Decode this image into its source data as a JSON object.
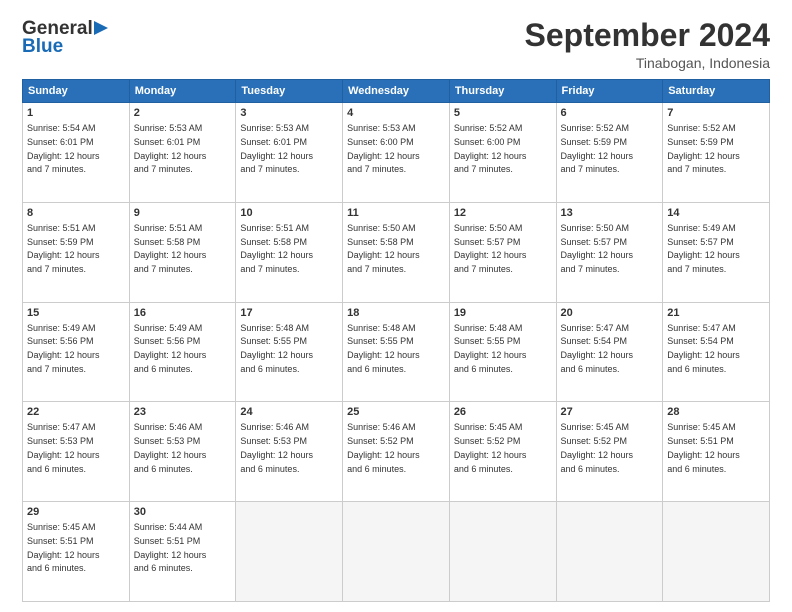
{
  "header": {
    "logo_general": "General",
    "logo_blue": "Blue",
    "month_title": "September 2024",
    "subtitle": "Tinabogan, Indonesia"
  },
  "days_of_week": [
    "Sunday",
    "Monday",
    "Tuesday",
    "Wednesday",
    "Thursday",
    "Friday",
    "Saturday"
  ],
  "weeks": [
    [
      {
        "day": 1,
        "sunrise": "5:54 AM",
        "sunset": "6:01 PM",
        "daylight": "12 hours and 7 minutes."
      },
      {
        "day": 2,
        "sunrise": "5:53 AM",
        "sunset": "6:01 PM",
        "daylight": "12 hours and 7 minutes."
      },
      {
        "day": 3,
        "sunrise": "5:53 AM",
        "sunset": "6:01 PM",
        "daylight": "12 hours and 7 minutes."
      },
      {
        "day": 4,
        "sunrise": "5:53 AM",
        "sunset": "6:00 PM",
        "daylight": "12 hours and 7 minutes."
      },
      {
        "day": 5,
        "sunrise": "5:52 AM",
        "sunset": "6:00 PM",
        "daylight": "12 hours and 7 minutes."
      },
      {
        "day": 6,
        "sunrise": "5:52 AM",
        "sunset": "5:59 PM",
        "daylight": "12 hours and 7 minutes."
      },
      {
        "day": 7,
        "sunrise": "5:52 AM",
        "sunset": "5:59 PM",
        "daylight": "12 hours and 7 minutes."
      }
    ],
    [
      {
        "day": 8,
        "sunrise": "5:51 AM",
        "sunset": "5:59 PM",
        "daylight": "12 hours and 7 minutes."
      },
      {
        "day": 9,
        "sunrise": "5:51 AM",
        "sunset": "5:58 PM",
        "daylight": "12 hours and 7 minutes."
      },
      {
        "day": 10,
        "sunrise": "5:51 AM",
        "sunset": "5:58 PM",
        "daylight": "12 hours and 7 minutes."
      },
      {
        "day": 11,
        "sunrise": "5:50 AM",
        "sunset": "5:58 PM",
        "daylight": "12 hours and 7 minutes."
      },
      {
        "day": 12,
        "sunrise": "5:50 AM",
        "sunset": "5:57 PM",
        "daylight": "12 hours and 7 minutes."
      },
      {
        "day": 13,
        "sunrise": "5:50 AM",
        "sunset": "5:57 PM",
        "daylight": "12 hours and 7 minutes."
      },
      {
        "day": 14,
        "sunrise": "5:49 AM",
        "sunset": "5:57 PM",
        "daylight": "12 hours and 7 minutes."
      }
    ],
    [
      {
        "day": 15,
        "sunrise": "5:49 AM",
        "sunset": "5:56 PM",
        "daylight": "12 hours and 7 minutes."
      },
      {
        "day": 16,
        "sunrise": "5:49 AM",
        "sunset": "5:56 PM",
        "daylight": "12 hours and 6 minutes."
      },
      {
        "day": 17,
        "sunrise": "5:48 AM",
        "sunset": "5:55 PM",
        "daylight": "12 hours and 6 minutes."
      },
      {
        "day": 18,
        "sunrise": "5:48 AM",
        "sunset": "5:55 PM",
        "daylight": "12 hours and 6 minutes."
      },
      {
        "day": 19,
        "sunrise": "5:48 AM",
        "sunset": "5:55 PM",
        "daylight": "12 hours and 6 minutes."
      },
      {
        "day": 20,
        "sunrise": "5:47 AM",
        "sunset": "5:54 PM",
        "daylight": "12 hours and 6 minutes."
      },
      {
        "day": 21,
        "sunrise": "5:47 AM",
        "sunset": "5:54 PM",
        "daylight": "12 hours and 6 minutes."
      }
    ],
    [
      {
        "day": 22,
        "sunrise": "5:47 AM",
        "sunset": "5:53 PM",
        "daylight": "12 hours and 6 minutes."
      },
      {
        "day": 23,
        "sunrise": "5:46 AM",
        "sunset": "5:53 PM",
        "daylight": "12 hours and 6 minutes."
      },
      {
        "day": 24,
        "sunrise": "5:46 AM",
        "sunset": "5:53 PM",
        "daylight": "12 hours and 6 minutes."
      },
      {
        "day": 25,
        "sunrise": "5:46 AM",
        "sunset": "5:52 PM",
        "daylight": "12 hours and 6 minutes."
      },
      {
        "day": 26,
        "sunrise": "5:45 AM",
        "sunset": "5:52 PM",
        "daylight": "12 hours and 6 minutes."
      },
      {
        "day": 27,
        "sunrise": "5:45 AM",
        "sunset": "5:52 PM",
        "daylight": "12 hours and 6 minutes."
      },
      {
        "day": 28,
        "sunrise": "5:45 AM",
        "sunset": "5:51 PM",
        "daylight": "12 hours and 6 minutes."
      }
    ],
    [
      {
        "day": 29,
        "sunrise": "5:45 AM",
        "sunset": "5:51 PM",
        "daylight": "12 hours and 6 minutes."
      },
      {
        "day": 30,
        "sunrise": "5:44 AM",
        "sunset": "5:51 PM",
        "daylight": "12 hours and 6 minutes."
      },
      null,
      null,
      null,
      null,
      null
    ]
  ]
}
